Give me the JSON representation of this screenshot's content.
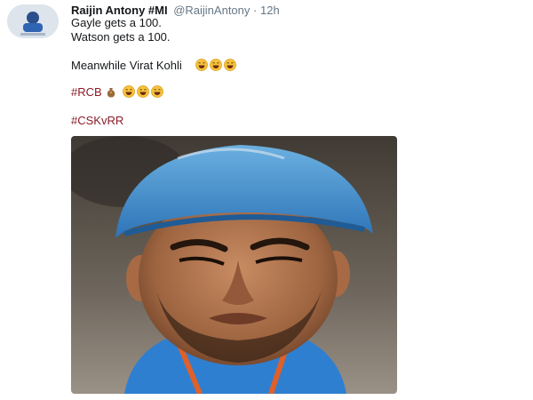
{
  "tweet": {
    "author_name": "Raijin Antony #MI",
    "handle": "@RaijinAntony",
    "separator": "·",
    "time": "12h",
    "lines": {
      "line1": "Gayle gets a 100.",
      "line2": "Watson gets a 100.",
      "line3": "Meanwhile Virat Kohli",
      "line4_hashtag": "#RCB",
      "line5_hashtag": "#CSKvRR"
    },
    "icons": {
      "avatar": "profile-avatar",
      "laugh": "grinning-face-emoji",
      "bag": "money-bag-emoji"
    },
    "colors": {
      "hashtag": "#8a1c29",
      "meta": "#657786",
      "emoji": "#f7c33b"
    }
  }
}
